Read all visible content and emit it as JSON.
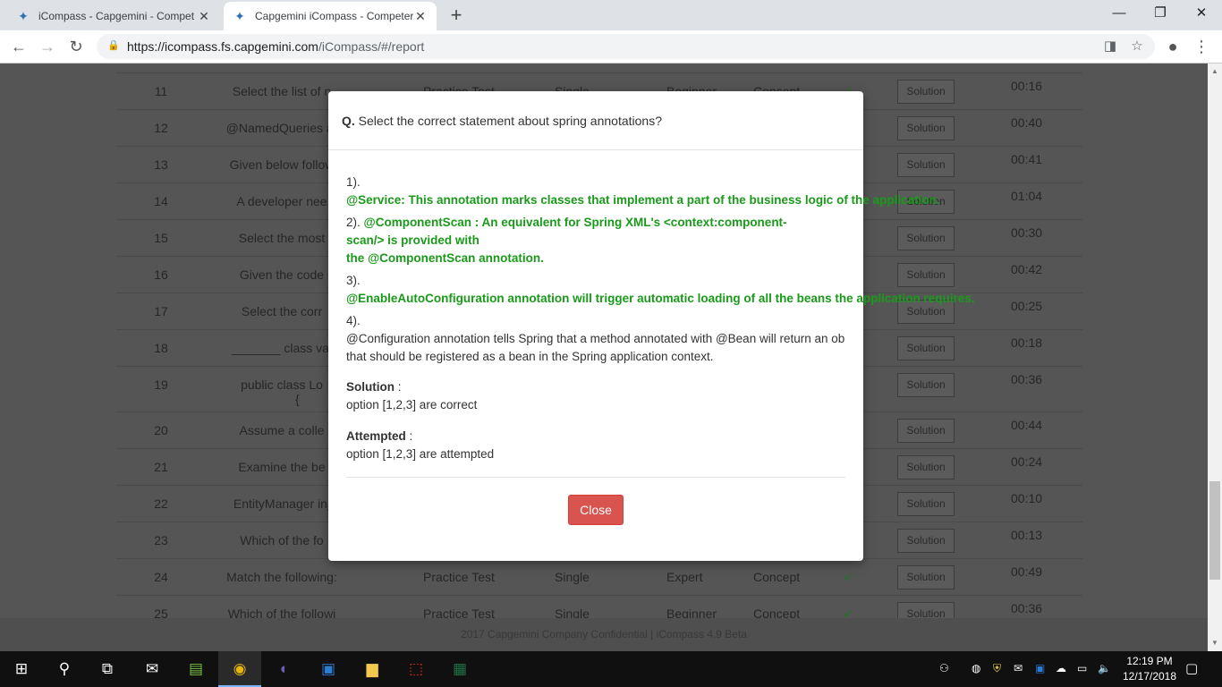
{
  "browser": {
    "tabs": [
      {
        "title": "iCompass - Capgemini - Compet",
        "active": false
      },
      {
        "title": "Capgemini iCompass - Competer",
        "active": true
      }
    ],
    "url_host": "https://icompass.fs.capgemini.com",
    "url_path": "/iCompass/#/report"
  },
  "table": {
    "rows": [
      {
        "num": "11",
        "question": "Select the list of n",
        "type": "Practice Test",
        "kind": "Single",
        "level": "Beginner",
        "category": "Concept",
        "solution": "Solution",
        "time": "00:16"
      },
      {
        "num": "12",
        "question": "@NamedQueries ar",
        "type": "",
        "kind": "",
        "level": "",
        "category": "",
        "solution": "Solution",
        "time": "00:40"
      },
      {
        "num": "13",
        "question": "Given below follow",
        "type": "",
        "kind": "",
        "level": "",
        "category": "",
        "solution": "Solution",
        "time": "00:41"
      },
      {
        "num": "14",
        "question": "A developer nee",
        "type": "",
        "kind": "",
        "level": "",
        "category": "",
        "solution": "Solution",
        "time": "01:04"
      },
      {
        "num": "15",
        "question": "Select the most",
        "type": "",
        "kind": "",
        "level": "",
        "category": "",
        "solution": "Solution",
        "time": "00:30"
      },
      {
        "num": "16",
        "question": "Given the code",
        "type": "",
        "kind": "",
        "level": "",
        "category": "",
        "solution": "Solution",
        "time": "00:42"
      },
      {
        "num": "17",
        "question": "Select the corr",
        "type": "",
        "kind": "",
        "level": "",
        "category": "",
        "solution": "Solution",
        "time": "00:25"
      },
      {
        "num": "18",
        "question": "_______ class val",
        "type": "",
        "kind": "",
        "level": "",
        "category": "",
        "solution": "Solution",
        "time": "00:18"
      },
      {
        "num": "19",
        "question": "public class Lo",
        "type": "",
        "kind": "",
        "level": "",
        "category": "",
        "solution": "Solution",
        "time": "00:36"
      },
      {
        "num": "20",
        "question": "Assume a colle",
        "type": "",
        "kind": "",
        "level": "",
        "category": "",
        "solution": "Solution",
        "time": "00:44"
      },
      {
        "num": "21",
        "question": "Examine the be",
        "type": "",
        "kind": "",
        "level": "",
        "category": "",
        "solution": "Solution",
        "time": "00:24"
      },
      {
        "num": "22",
        "question": "EntityManager inj",
        "type": "",
        "kind": "",
        "level": "",
        "category": "",
        "solution": "Solution",
        "time": "00:10"
      },
      {
        "num": "23",
        "question": "Which of the fo",
        "type": "",
        "kind": "",
        "level": "",
        "category": "",
        "solution": "Solution",
        "time": "00:13"
      },
      {
        "num": "24",
        "question": "Match the following:",
        "type": "Practice Test",
        "kind": "Single",
        "level": "Expert",
        "category": "Concept",
        "solution": "Solution",
        "time": "00:49"
      },
      {
        "num": "25",
        "question": "Which of the followi",
        "type": "Practice Test",
        "kind": "Single",
        "level": "Beginner",
        "category": "Concept",
        "solution": "Solution",
        "time": "00:36"
      }
    ],
    "row_19_extra": "{"
  },
  "footer": "2017 Capgemini Company Confidential | iCompass 4.9 Beta",
  "modal": {
    "q_prefix": "Q.",
    "question": "Select the correct statement about spring annotations?",
    "opt1_num": "1).",
    "opt1_text": "@Service: This annotation marks classes that implement a part of the business logic of the application.",
    "opt2_num": "2).",
    "opt2_text_a": "@ComponentScan : An equivalent for Spring XML's <context:component-",
    "opt2_text_b": "scan/> is provided with",
    "opt2_text_c": "the @ComponentScan annotation.",
    "opt3_num": "3).",
    "opt3_text": "@EnableAutoConfiguration annotation  will trigger automatic loading of all the beans the application requires.",
    "opt4_num": "4).",
    "opt4_text_a": "@Configuration  annotation tells Spring that a method annotated with @Bean will return an ob",
    "opt4_text_b": "that should be registered as a bean in the Spring application context.",
    "solution_label": "Solution",
    "solution_colon": " :",
    "solution_value": "option [1,2,3] are correct",
    "attempted_label": "Attempted",
    "attempted_colon": " :",
    "attempted_value": "option [1,2,3] are attempted",
    "close_label": "Close",
    "answer_color": "#1a9a1a",
    "close_color": "#d9534f"
  },
  "taskbar": {
    "time": "12:19 PM",
    "date": "12/17/2018"
  }
}
